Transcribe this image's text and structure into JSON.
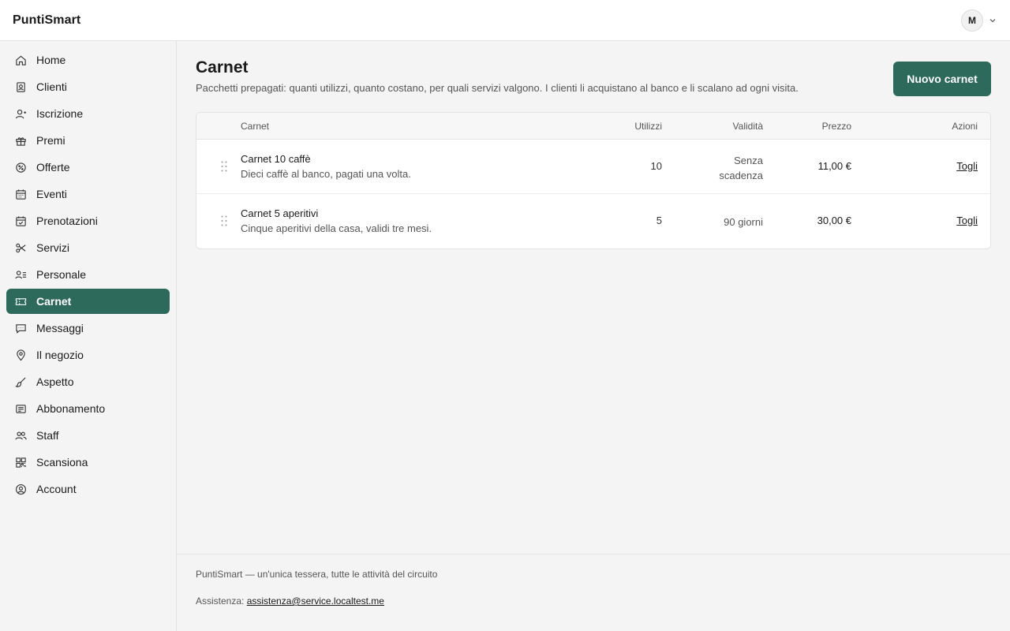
{
  "app": {
    "brand": "PuntiSmart"
  },
  "user": {
    "initial": "M"
  },
  "sidebar": {
    "items": [
      {
        "label": "Home",
        "icon": "home-icon"
      },
      {
        "label": "Clienti",
        "icon": "contacts-icon"
      },
      {
        "label": "Iscrizione",
        "icon": "user-plus-icon"
      },
      {
        "label": "Premi",
        "icon": "gift-icon"
      },
      {
        "label": "Offerte",
        "icon": "percent-badge-icon"
      },
      {
        "label": "Eventi",
        "icon": "calendar-icon"
      },
      {
        "label": "Prenotazioni",
        "icon": "calendar-check-icon"
      },
      {
        "label": "Servizi",
        "icon": "scissors-icon"
      },
      {
        "label": "Personale",
        "icon": "user-list-icon"
      },
      {
        "label": "Carnet",
        "icon": "ticket-icon",
        "active": true
      },
      {
        "label": "Messaggi",
        "icon": "message-icon"
      },
      {
        "label": "Il negozio",
        "icon": "map-pin-icon"
      },
      {
        "label": "Aspetto",
        "icon": "brush-icon"
      },
      {
        "label": "Abbonamento",
        "icon": "receipt-icon"
      },
      {
        "label": "Staff",
        "icon": "users-icon"
      },
      {
        "label": "Scansiona",
        "icon": "qr-icon"
      },
      {
        "label": "Account",
        "icon": "user-circle-icon"
      }
    ]
  },
  "page": {
    "title": "Carnet",
    "description": "Pacchetti prepagati: quanti utilizzi, quanto costano, per quali servizi valgono. I clienti li acquistano al banco e li scalano ad ogni visita.",
    "new_button": "Nuovo carnet"
  },
  "table": {
    "headers": {
      "name": "Carnet",
      "uses": "Utilizzi",
      "validity": "Validità",
      "price": "Prezzo",
      "actions": "Azioni"
    },
    "rows": [
      {
        "name": "Carnet 10 caffè",
        "description": "Dieci caffè al banco, pagati una volta.",
        "uses": "10",
        "validity": "Senza scadenza",
        "price": "11,00 €",
        "action": "Togli"
      },
      {
        "name": "Carnet 5 aperitivi",
        "description": "Cinque aperitivi della casa, validi tre mesi.",
        "uses": "5",
        "validity": "90 giorni",
        "price": "30,00 €",
        "action": "Togli"
      }
    ]
  },
  "footer": {
    "tagline": "PuntiSmart — un'unica tessera, tutte le attività del circuito",
    "support_label": "Assistenza:",
    "support_email": "assistenza@service.localtest.me"
  },
  "colors": {
    "accent": "#2d6a5c",
    "background": "#f4f4f4",
    "surface": "#ffffff"
  }
}
